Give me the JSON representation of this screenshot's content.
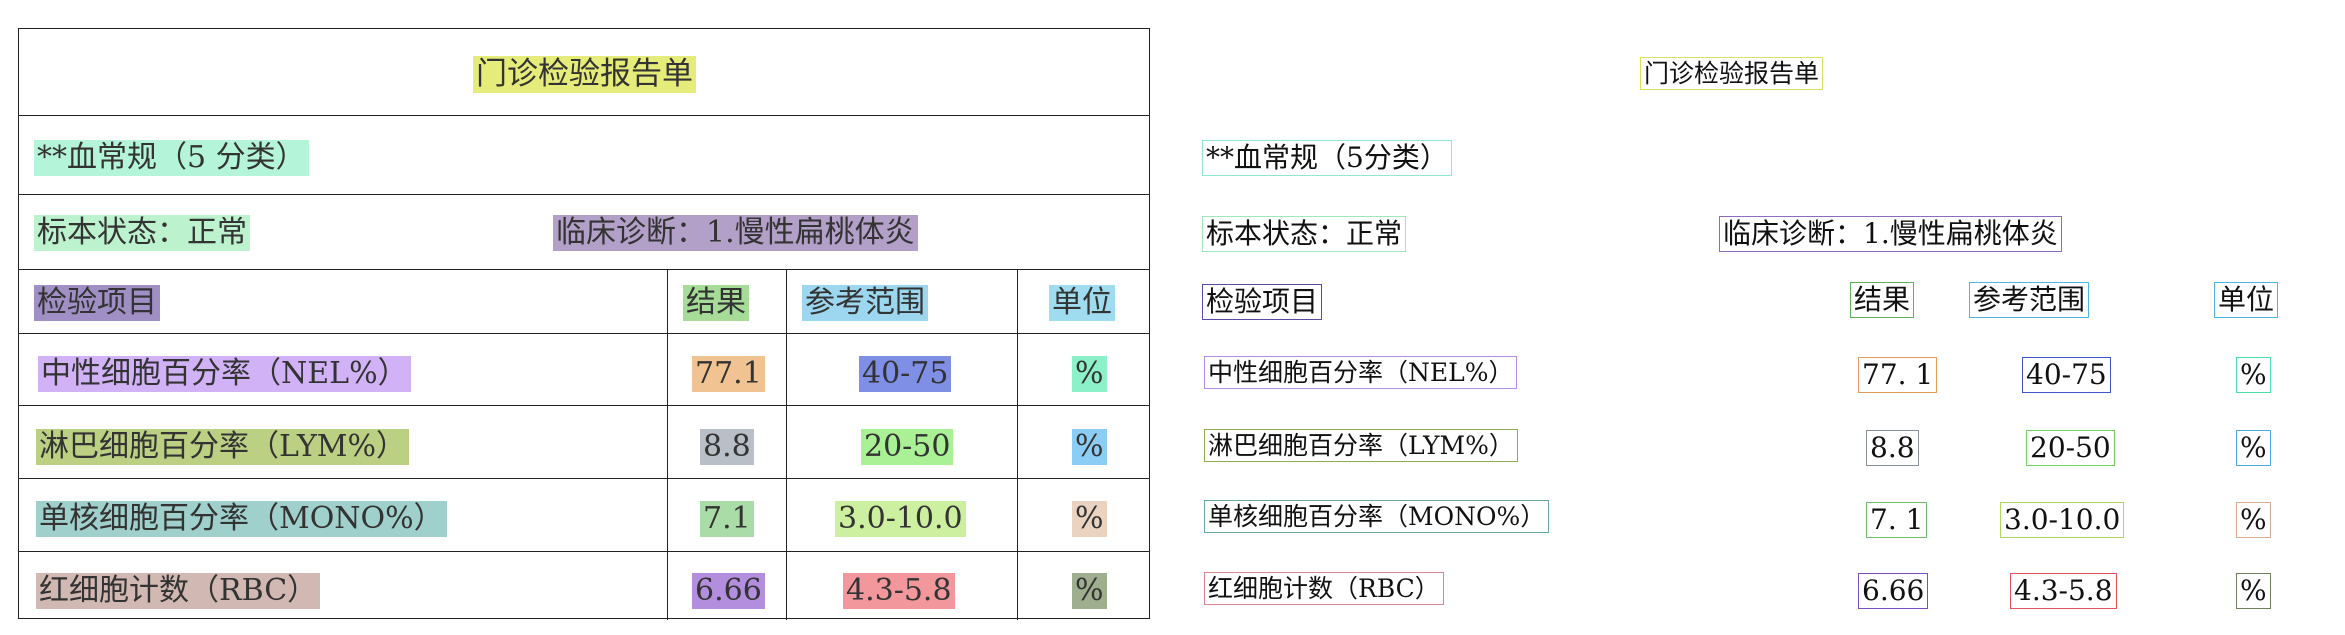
{
  "report": {
    "title": "门诊检验报告单",
    "section": "**血常规（5 分类）",
    "section_alt": "**血常规（5分类）",
    "specimen_state": "标本状态：正常",
    "diagnosis": "临床诊断：1.慢性扁桃体炎",
    "headers": {
      "item": "检验项目",
      "result": "结果",
      "range": "参考范围",
      "unit": "单位"
    },
    "rows": [
      {
        "item": "中性细胞百分率（NEL%）",
        "result": "77.1",
        "result_alt": "77. 1",
        "range": "40-75",
        "unit": "%"
      },
      {
        "item": "淋巴细胞百分率（LYM%）",
        "result": "8.8",
        "result_alt": "8.8",
        "range": "20-50",
        "unit": "%"
      },
      {
        "item": "单核细胞百分率（MONO%）",
        "result": "7.1",
        "result_alt": "7. 1",
        "range": "3.0-10.0",
        "unit": "%"
      },
      {
        "item": "红细胞计数（RBC）",
        "result": "6.66",
        "result_alt": "6.66",
        "range": "4.3-5.8",
        "unit": "%"
      }
    ]
  },
  "colors": {
    "title": "#e6ec7a",
    "section": "#b4f5da",
    "specimen": "#bdf2cf",
    "diagnosis": "#b3a0c8",
    "header_item": "#9f8fc4",
    "header_result": "#a6dc98",
    "header_range": "#9dd7ef",
    "header_unit": "#9fdcf0",
    "row0_item": "#d2b2f7",
    "row0_result": "#f1c292",
    "row0_range": "#7f8fe6",
    "row0_unit": "#8cf1c9",
    "row1_item": "#bcd084",
    "row1_result": "#b9bfc6",
    "row1_range": "#a9f194",
    "row1_unit": "#8ccdf6",
    "row2_item": "#9fd0cb",
    "row2_result": "#a9dca7",
    "row2_range": "#cdf0a0",
    "row2_unit": "#ead3c1",
    "row3_item": "#d2b8b2",
    "row3_result": "#b48ede",
    "row3_range": "#f2979c",
    "row3_unit": "#9eae8e"
  }
}
